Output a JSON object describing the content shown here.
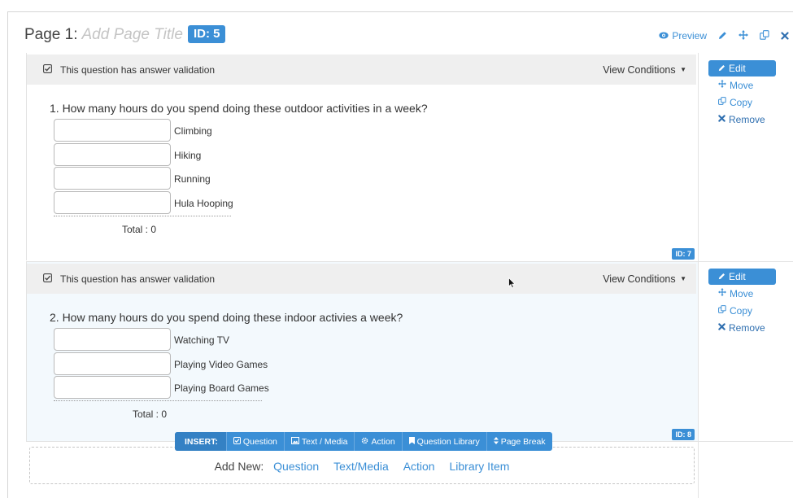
{
  "page": {
    "title_prefix": "Page 1:",
    "title_placeholder": "Add Page Title",
    "id_badge": "ID: 5",
    "preview_label": "Preview"
  },
  "questions": [
    {
      "validation_text": "This question has answer validation",
      "view_conditions": "View Conditions",
      "text": "1. How many hours do you spend doing these outdoor activities in a week?",
      "rows": [
        {
          "label": "Climbing",
          "value": ""
        },
        {
          "label": "Hiking",
          "value": ""
        },
        {
          "label": "Running",
          "value": ""
        },
        {
          "label": "Hula Hooping",
          "value": ""
        }
      ],
      "total": "Total : 0",
      "id": "ID: 7",
      "actions": {
        "edit": "Edit",
        "move": "Move",
        "copy": "Copy",
        "remove": "Remove"
      }
    },
    {
      "validation_text": "This question has answer validation",
      "view_conditions": "View Conditions",
      "text": "2. How many hours do you spend doing these indoor activies a week?",
      "rows": [
        {
          "label": "Watching TV",
          "value": ""
        },
        {
          "label": "Playing Video Games",
          "value": ""
        },
        {
          "label": "Playing Board Games",
          "value": ""
        }
      ],
      "total": "Total : 0",
      "id": "ID: 8",
      "actions": {
        "edit": "Edit",
        "move": "Move",
        "copy": "Copy",
        "remove": "Remove"
      }
    }
  ],
  "insert_bar": {
    "label": "INSERT:",
    "items": [
      "Question",
      "Text / Media",
      "Action",
      "Question Library",
      "Page Break"
    ]
  },
  "add_new": {
    "label": "Add New:",
    "links": [
      "Question",
      "Text/Media",
      "Action",
      "Library Item"
    ]
  },
  "colors": {
    "accent": "#3b8fd6",
    "question_highlight_bg": "#f3f9fd",
    "validation_bar_bg": "#efefef"
  },
  "icons": [
    "eye-icon",
    "pencil-icon",
    "move-arrows-icon",
    "copy-icon",
    "close-icon",
    "checkbox-check-icon",
    "caret-down-icon",
    "image-icon",
    "gear-icon",
    "bookmark-icon",
    "sort-icon",
    "mouse-cursor-icon"
  ]
}
